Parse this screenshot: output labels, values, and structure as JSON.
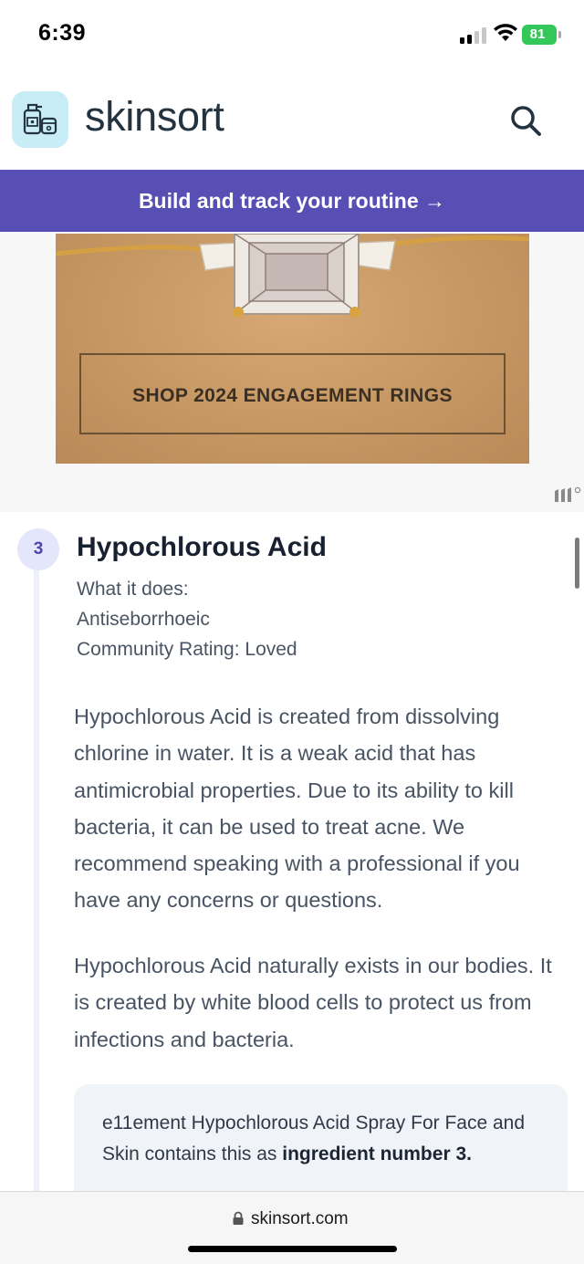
{
  "status_bar": {
    "time": "6:39",
    "battery": "81"
  },
  "header": {
    "logo_text": "skinsort",
    "search_icon": "search-icon"
  },
  "promo": {
    "label": "Build and track your routine →"
  },
  "ad": {
    "cta": "SHOP 2024 ENGAGEMENT RINGS"
  },
  "ingredient": {
    "step": "3",
    "title": "Hypochlorous Acid",
    "what_it_does_label": "What it does:",
    "what_it_does_value": "Antiseborrhoeic",
    "community_rating": "Community Rating:  Loved",
    "description_1": "Hypochlorous Acid is created from dissolving chlorine in water. It is a weak acid that has antimicrobial properties. Due to its ability to kill bacteria, it can be used to treat acne. We recommend speaking with a professional if you have any concerns or questions.",
    "description_2": "Hypochlorous Acid naturally exists in our bodies. It is created by white blood cells to protect us from infections and bacteria."
  },
  "product_card": {
    "text_prefix": "e11ement Hypochlorous Acid Spray For Face and Skin contains this as ",
    "text_bold": "ingredient number 3."
  },
  "browser": {
    "url": "skinsort.com"
  },
  "colors": {
    "brand_purple": "#584fb4",
    "logo_bg": "#c9edf7",
    "battery_green": "#34c759"
  }
}
